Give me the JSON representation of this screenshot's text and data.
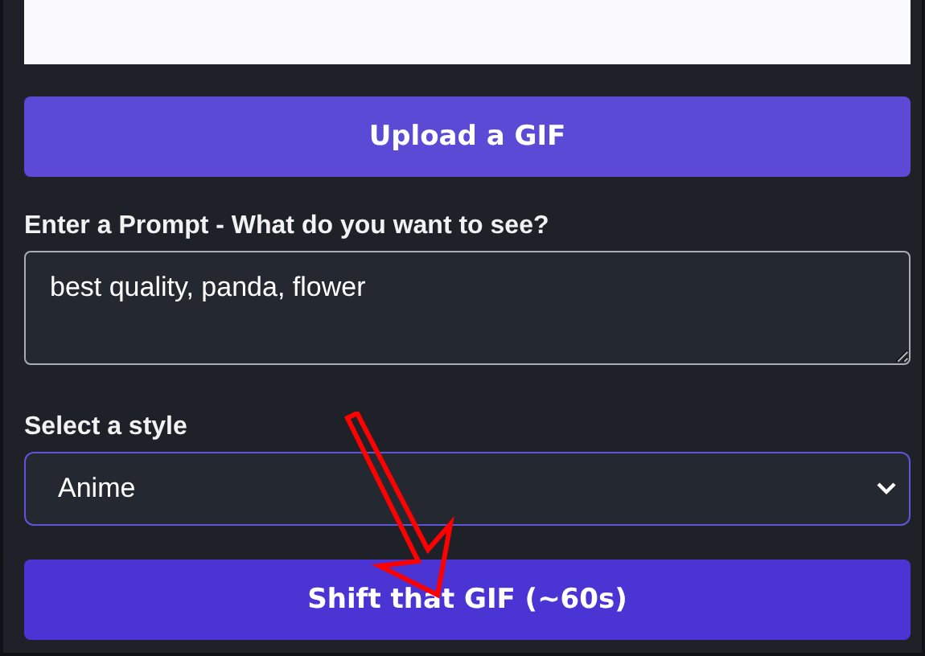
{
  "upload_button": "Upload a GIF",
  "prompt": {
    "label": "Enter a Prompt - What do you want to see?",
    "value": "best quality, panda, flower"
  },
  "style": {
    "label": "Select a style",
    "value": "Anime"
  },
  "submit_button": "Shift that GIF (~60s)"
}
